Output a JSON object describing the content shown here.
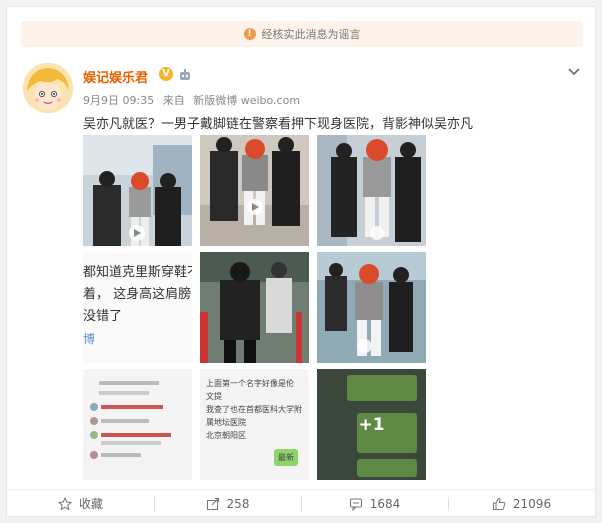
{
  "notice": {
    "text": "经核实此消息为谣言",
    "icon": "warning-icon"
  },
  "post": {
    "author": "娱记娱乐君",
    "verified_badge": "V",
    "time": "9月9日 09:35",
    "source_prefix": "来自",
    "source": "新版微博 weibo.com",
    "text": "吴亦凡就医？一男子戴脚链在警察看押下现身医院，背影神似吴亦凡",
    "image_overflow": "+1",
    "image_text_tile": {
      "lines": [
        "都知道克里斯穿鞋不",
        "着， 这身高这肩膀",
        "没错了"
      ],
      "tag": "博"
    },
    "chat_tile": {
      "lines": [
        "上面第一个名字好像是伦",
        "文提",
        "",
        "我查了也在首都医科大学附",
        "属地坛医院",
        "",
        "北京朝阳区"
      ],
      "tag": "最新"
    }
  },
  "footer": {
    "favorite_label": "收藏",
    "repost_count": "258",
    "comment_count": "1684",
    "like_count": "21096"
  },
  "colors": {
    "author": "#e86000",
    "notice_bg": "#fdf3ea",
    "notice_icon": "#f2994a",
    "vip": "#f2b52b"
  }
}
